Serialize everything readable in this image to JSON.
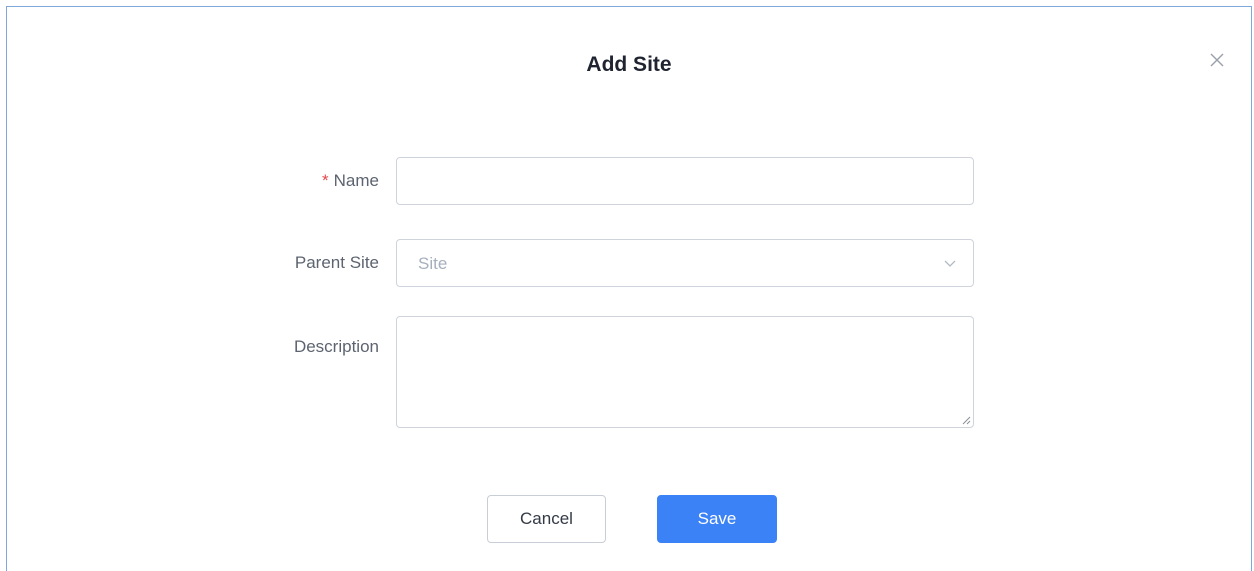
{
  "dialog": {
    "title": "Add Site",
    "close_icon": "close-icon"
  },
  "form": {
    "name": {
      "required_mark": "*",
      "label": "Name",
      "value": ""
    },
    "parent_site": {
      "label": "Parent Site",
      "placeholder": "Site",
      "icon": "chevron-down-icon"
    },
    "description": {
      "label": "Description",
      "value": ""
    }
  },
  "actions": {
    "cancel_label": "Cancel",
    "save_label": "Save"
  },
  "colors": {
    "primary": "#3b82f6",
    "required": "#e5484d",
    "dialog_border": "#7fa7d9"
  }
}
